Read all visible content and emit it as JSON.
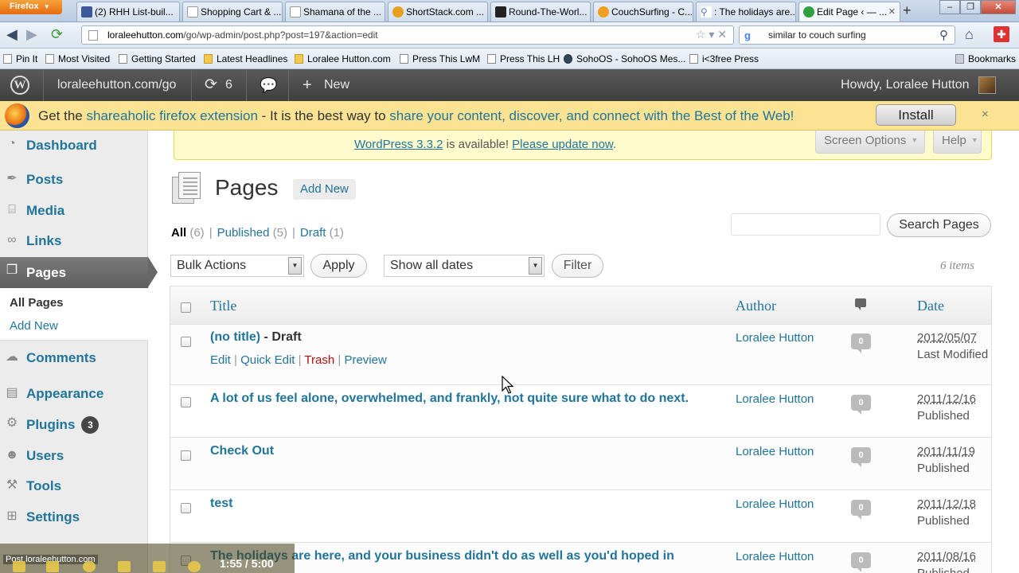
{
  "browser": {
    "menu_button": "Firefox",
    "tabs": [
      {
        "label": "(2) RHH List-buil...",
        "favicon_color": "#3b5998"
      },
      {
        "label": "Shopping Cart & ...",
        "favicon_color": "#ffffff"
      },
      {
        "label": "Shamana of the ...",
        "favicon_color": "#ffffff"
      },
      {
        "label": "ShortStack.com ...",
        "favicon_color": "#e8a020"
      },
      {
        "label": "Round-The-Worl...",
        "favicon_color": "#222222"
      },
      {
        "label": "CouchSurfing - C...",
        "favicon_color": "#f0a020"
      },
      {
        "label": ": The holidays are...",
        "favicon_color": "#5577bb"
      },
      {
        "label": "Edit Page ‹ — ...",
        "favicon_color": "#30a040"
      }
    ],
    "url_host": "loraleehutton.com",
    "url_path": "/go/wp-admin/post.php?post=197&action=edit",
    "search_value": "similar to couch surfing",
    "bookmarks": [
      {
        "label": "Pin It",
        "icon": "page"
      },
      {
        "label": "Most Visited",
        "icon": "page"
      },
      {
        "label": "Getting Started",
        "icon": "page"
      },
      {
        "label": "Latest Headlines",
        "icon": "folder"
      },
      {
        "label": "Loralee Hutton.com",
        "icon": "folder"
      },
      {
        "label": "Press This LwM",
        "icon": "page"
      },
      {
        "label": "Press This LH",
        "icon": "page"
      },
      {
        "label": "SohoOS - SohoOS Mes...",
        "icon": "globe"
      },
      {
        "label": "i<3free Press",
        "icon": "page"
      }
    ],
    "bookmarks_menu": "Bookmarks"
  },
  "adminbar": {
    "site_name": "loraleehutton.com/go",
    "updates_count": "6",
    "new_label": "New",
    "howdy": "Howdy, Loralee Hutton"
  },
  "notification": {
    "prefix": "Get the ",
    "link1": "shareaholic firefox extension",
    "middle": " - It is the best way to ",
    "link2": "share your content, discover, and connect with the Best of the Web!",
    "install": "Install",
    "close": "×"
  },
  "sidebar": {
    "items": [
      {
        "label": "Dashboard",
        "icon": "dashboard-icon",
        "glyph": "◔"
      },
      {
        "label": "Posts",
        "icon": "pin-icon",
        "glyph": "✒"
      },
      {
        "label": "Media",
        "icon": "media-icon",
        "glyph": "⌸"
      },
      {
        "label": "Links",
        "icon": "link-icon",
        "glyph": "∞"
      },
      {
        "label": "Pages",
        "icon": "pages-icon",
        "glyph": "❐"
      },
      {
        "label": "Comments",
        "icon": "comment-icon",
        "glyph": "☁"
      },
      {
        "label": "Appearance",
        "icon": "appearance-icon",
        "glyph": "▤"
      },
      {
        "label": "Plugins",
        "icon": "plugin-icon",
        "glyph": "⚙"
      },
      {
        "label": "Users",
        "icon": "users-icon",
        "glyph": "☻"
      },
      {
        "label": "Tools",
        "icon": "tools-icon",
        "glyph": "⚒"
      },
      {
        "label": "Settings",
        "icon": "settings-icon",
        "glyph": "⊞"
      }
    ],
    "plugins_badge": "3",
    "submenu": [
      "All Pages",
      "Add New"
    ]
  },
  "update_nag": {
    "version_link": "WordPress 3.3.2",
    "text": " is available! ",
    "update_link": "Please update now",
    "end": "."
  },
  "screen_options": "Screen Options",
  "help": "Help",
  "page": {
    "title": "Pages",
    "add_new": "Add New",
    "filters": [
      {
        "label": "All",
        "count": "(6)"
      },
      {
        "label": "Published",
        "count": "(5)"
      },
      {
        "label": "Draft",
        "count": "(1)"
      }
    ],
    "search_button": "Search Pages",
    "bulk_actions": "Bulk Actions",
    "apply": "Apply",
    "dates": "Show all dates",
    "filter": "Filter",
    "items_count": "6 items"
  },
  "table": {
    "columns": {
      "title": "Title",
      "author": "Author",
      "date": "Date"
    },
    "rows": [
      {
        "title": "(no title)",
        "state": " - Draft",
        "author": "Loralee Hutton",
        "comments": "0",
        "date": "2012/05/07",
        "status": "Last Modified"
      },
      {
        "title": "A lot of us feel alone, overwhelmed, and frankly, not quite sure what to do next.",
        "state": "",
        "author": "Loralee Hutton",
        "comments": "0",
        "date": "2011/12/16",
        "status": "Published"
      },
      {
        "title": "Check Out",
        "state": "",
        "author": "Loralee Hutton",
        "comments": "0",
        "date": "2011/11/19",
        "status": "Published"
      },
      {
        "title": "test",
        "state": "",
        "author": "Loralee Hutton",
        "comments": "0",
        "date": "2011/12/18",
        "status": "Published"
      },
      {
        "title": "The holidays are here, and your business didn't do as well as you'd hoped in",
        "state": "",
        "author": "Loralee Hutton",
        "comments": "0",
        "date": "2011/08/16",
        "status": "Published"
      }
    ],
    "row_actions": {
      "edit": "Edit",
      "quick_edit": "Quick Edit",
      "trash": "Trash",
      "preview": "Preview",
      "sep": " | "
    }
  },
  "player": {
    "url": "Post loraleehutton.com",
    "time": "1:55 / 5:00"
  }
}
